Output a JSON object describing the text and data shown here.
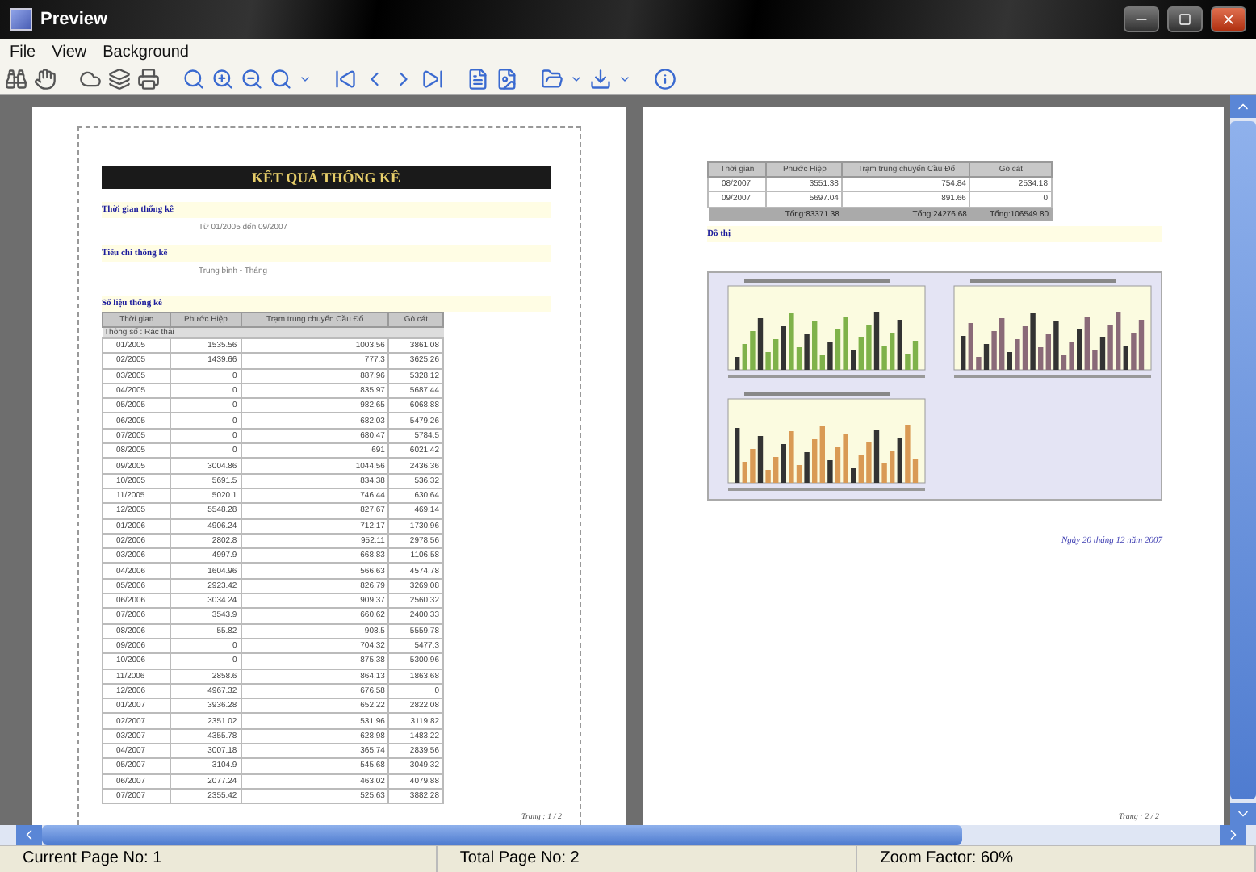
{
  "window": {
    "title": "Preview"
  },
  "menu": [
    "File",
    "View",
    "Background"
  ],
  "report": {
    "title": "KẾT QUẢ THỐNG KÊ",
    "sections": [
      {
        "label": "Thời gian thống kê",
        "value": "Từ 01/2005 đến 09/2007"
      },
      {
        "label": "Tiêu chí thống kê",
        "value": "Trung bình - Tháng"
      }
    ],
    "table_label": "Số liệu thống kê",
    "columns": [
      "Thời gian",
      "Phước Hiệp",
      "Trạm trung chuyển Cầu Đổ",
      "Gò cát"
    ],
    "group": "Thông số : Rác thải",
    "rows": [
      [
        "01/2005",
        "1535.56",
        "1003.56",
        "3861.08"
      ],
      [
        "02/2005",
        "1439.66",
        "777.3",
        "3625.26"
      ],
      [
        "03/2005",
        "0",
        "887.96",
        "5328.12"
      ],
      [
        "04/2005",
        "0",
        "835.97",
        "5687.44"
      ],
      [
        "05/2005",
        "0",
        "982.65",
        "6068.88"
      ],
      [
        "06/2005",
        "0",
        "682.03",
        "5479.26"
      ],
      [
        "07/2005",
        "0",
        "680.47",
        "5784.5"
      ],
      [
        "08/2005",
        "0",
        "691",
        "6021.42"
      ],
      [
        "09/2005",
        "3004.86",
        "1044.56",
        "2436.36"
      ],
      [
        "10/2005",
        "5691.5",
        "834.38",
        "536.32"
      ],
      [
        "11/2005",
        "5020.1",
        "746.44",
        "630.64"
      ],
      [
        "12/2005",
        "5548.28",
        "827.67",
        "469.14"
      ],
      [
        "01/2006",
        "4906.24",
        "712.17",
        "1730.96"
      ],
      [
        "02/2006",
        "2802.8",
        "952.11",
        "2978.56"
      ],
      [
        "03/2006",
        "4997.9",
        "668.83",
        "1106.58"
      ],
      [
        "04/2006",
        "1604.96",
        "566.63",
        "4574.78"
      ],
      [
        "05/2006",
        "2923.42",
        "826.79",
        "3269.08"
      ],
      [
        "06/2006",
        "3034.24",
        "909.37",
        "2560.32"
      ],
      [
        "07/2006",
        "3543.9",
        "660.62",
        "2400.33"
      ],
      [
        "08/2006",
        "55.82",
        "908.5",
        "5559.78"
      ],
      [
        "09/2006",
        "0",
        "704.32",
        "5477.3"
      ],
      [
        "10/2006",
        "0",
        "875.38",
        "5300.96"
      ],
      [
        "11/2006",
        "2858.6",
        "864.13",
        "1863.68"
      ],
      [
        "12/2006",
        "4967.32",
        "676.58",
        "0"
      ],
      [
        "01/2007",
        "3936.28",
        "652.22",
        "2822.08"
      ],
      [
        "02/2007",
        "2351.02",
        "531.96",
        "3119.82"
      ],
      [
        "03/2007",
        "4355.78",
        "628.98",
        "1483.22"
      ],
      [
        "04/2007",
        "3007.18",
        "365.74",
        "2839.56"
      ],
      [
        "05/2007",
        "3104.9",
        "545.68",
        "3049.32"
      ],
      [
        "06/2007",
        "2077.24",
        "463.02",
        "4079.88"
      ],
      [
        "07/2007",
        "2355.42",
        "525.63",
        "3882.28"
      ]
    ],
    "footer": "Trang : 1 / 2"
  },
  "page2": {
    "columns": [
      "Thời gian",
      "Phước Hiệp",
      "Trạm trung chuyển Cầu Đổ",
      "Gò cát"
    ],
    "rows": [
      [
        "08/2007",
        "3551.38",
        "754.84",
        "2534.18"
      ],
      [
        "09/2007",
        "5697.04",
        "891.66",
        "0"
      ]
    ],
    "totals": [
      "Tổng:83371.38",
      "Tổng:24276.68",
      "Tổng:106549.80"
    ],
    "chart_label": "Đồ thị",
    "charts": [
      {
        "color": "#7fb24a"
      },
      {
        "color": "#8a6a78"
      },
      {
        "color": "#d99a55"
      }
    ],
    "date": "Ngày 20 tháng 12 năm 2007",
    "footer": "Trang : 2 / 2"
  },
  "status_bar": [
    "Current Page No: 1",
    "Total Page No: 2",
    "Zoom Factor: 60%"
  ]
}
